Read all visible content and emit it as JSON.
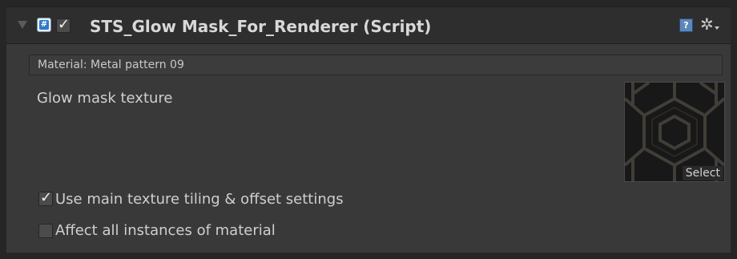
{
  "component": {
    "title": "STS_Glow Mask_For_Renderer (Script)",
    "enabled": true,
    "icons": {
      "script": "csharp-script-icon",
      "script_glyph": "#",
      "help": "help-icon",
      "help_glyph": "?",
      "settings": "gear-icon",
      "settings_glyph": "✲"
    }
  },
  "material": {
    "text": "Material: Metal pattern 09"
  },
  "glow_mask": {
    "label": "Glow mask texture",
    "select_label": "Select"
  },
  "options": {
    "use_main_tiling": {
      "label": "Use main texture tiling & offset settings",
      "checked": true
    },
    "affect_all_instances": {
      "label": "Affect all instances of material",
      "checked": false
    }
  },
  "colors": {
    "panel": "#393939",
    "header": "#2e2e2e",
    "accent_blue": "#2f79c8",
    "pattern": "#3b3a33"
  }
}
